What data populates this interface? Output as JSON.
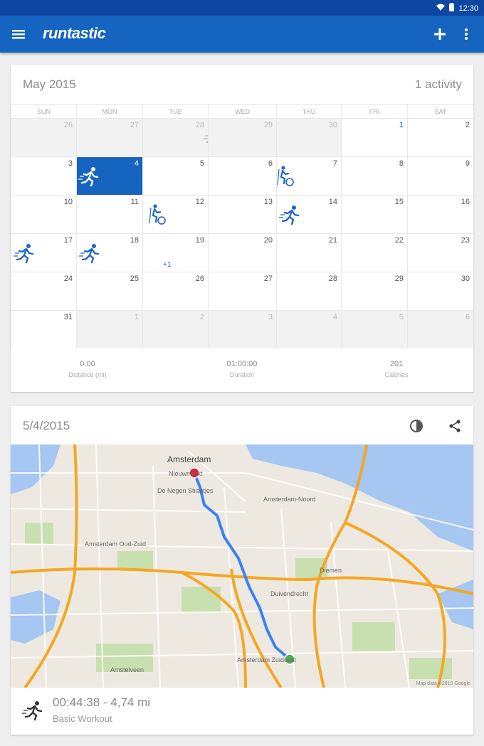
{
  "status_bar": {
    "time": "12:30"
  },
  "app_bar": {
    "logo_text": "runtastic"
  },
  "calendar": {
    "title": "May 2015",
    "activity_count": "1 activity",
    "weekdays": [
      "SUN",
      "MON",
      "TUE",
      "WED",
      "THU",
      "FRI",
      "SAT"
    ],
    "weeks": [
      [
        {
          "day": "26",
          "other": true
        },
        {
          "day": "27",
          "other": true
        },
        {
          "day": "28",
          "other": true,
          "activity": "run-faded"
        },
        {
          "day": "29",
          "other": true
        },
        {
          "day": "30",
          "other": true
        },
        {
          "day": "1",
          "first": true
        },
        {
          "day": "2"
        }
      ],
      [
        {
          "day": "3"
        },
        {
          "day": "4",
          "selected": true,
          "activity": "run"
        },
        {
          "day": "5"
        },
        {
          "day": "6"
        },
        {
          "day": "7",
          "activity": "cycle"
        },
        {
          "day": "8"
        },
        {
          "day": "9"
        }
      ],
      [
        {
          "day": "10"
        },
        {
          "day": "11"
        },
        {
          "day": "12",
          "activity": "cycle"
        },
        {
          "day": "13"
        },
        {
          "day": "14",
          "activity": "run"
        },
        {
          "day": "15"
        },
        {
          "day": "16"
        }
      ],
      [
        {
          "day": "17",
          "activity": "run"
        },
        {
          "day": "18",
          "activity": "run",
          "extra": "+1"
        },
        {
          "day": "19"
        },
        {
          "day": "20"
        },
        {
          "day": "21"
        },
        {
          "day": "22"
        },
        {
          "day": "23"
        }
      ],
      [
        {
          "day": "24"
        },
        {
          "day": "25"
        },
        {
          "day": "26"
        },
        {
          "day": "27"
        },
        {
          "day": "28"
        },
        {
          "day": "29"
        },
        {
          "day": "30"
        }
      ],
      [
        {
          "day": "31"
        },
        {
          "day": "1",
          "other": true
        },
        {
          "day": "2",
          "other": true
        },
        {
          "day": "3",
          "other": true
        },
        {
          "day": "4",
          "other": true
        },
        {
          "day": "5",
          "other": true
        },
        {
          "day": "6",
          "other": true
        }
      ]
    ],
    "stats": [
      {
        "value": "0.00",
        "label": "Distance (mi)"
      },
      {
        "value": "01:00:00",
        "label": "Duration"
      },
      {
        "value": "201",
        "label": "Calories"
      }
    ]
  },
  "activity": {
    "date": "5/4/2015",
    "map": {
      "labels": [
        "Amsterdam",
        "Nieuwmarkt",
        "De Negen Straatjes",
        "Amsterdam-Noord",
        "Amsterdam Oud-Zuid",
        "Diemen",
        "Duivendrecht",
        "Amstelveen",
        "Amsterdam Zuidoost"
      ],
      "attribution": "Map data ©2015 Google"
    },
    "summary_main": "00:44:38 - 4,74 mi",
    "summary_sub": "Basic Workout"
  },
  "colors": {
    "app_bar": "#1565c0",
    "status_bar": "#0d47a1",
    "selected_day": "#1565c0",
    "route": "#3b82f6",
    "start_marker": "#4caf50",
    "end_marker": "#e91e3c",
    "highway": "#f5a623"
  }
}
